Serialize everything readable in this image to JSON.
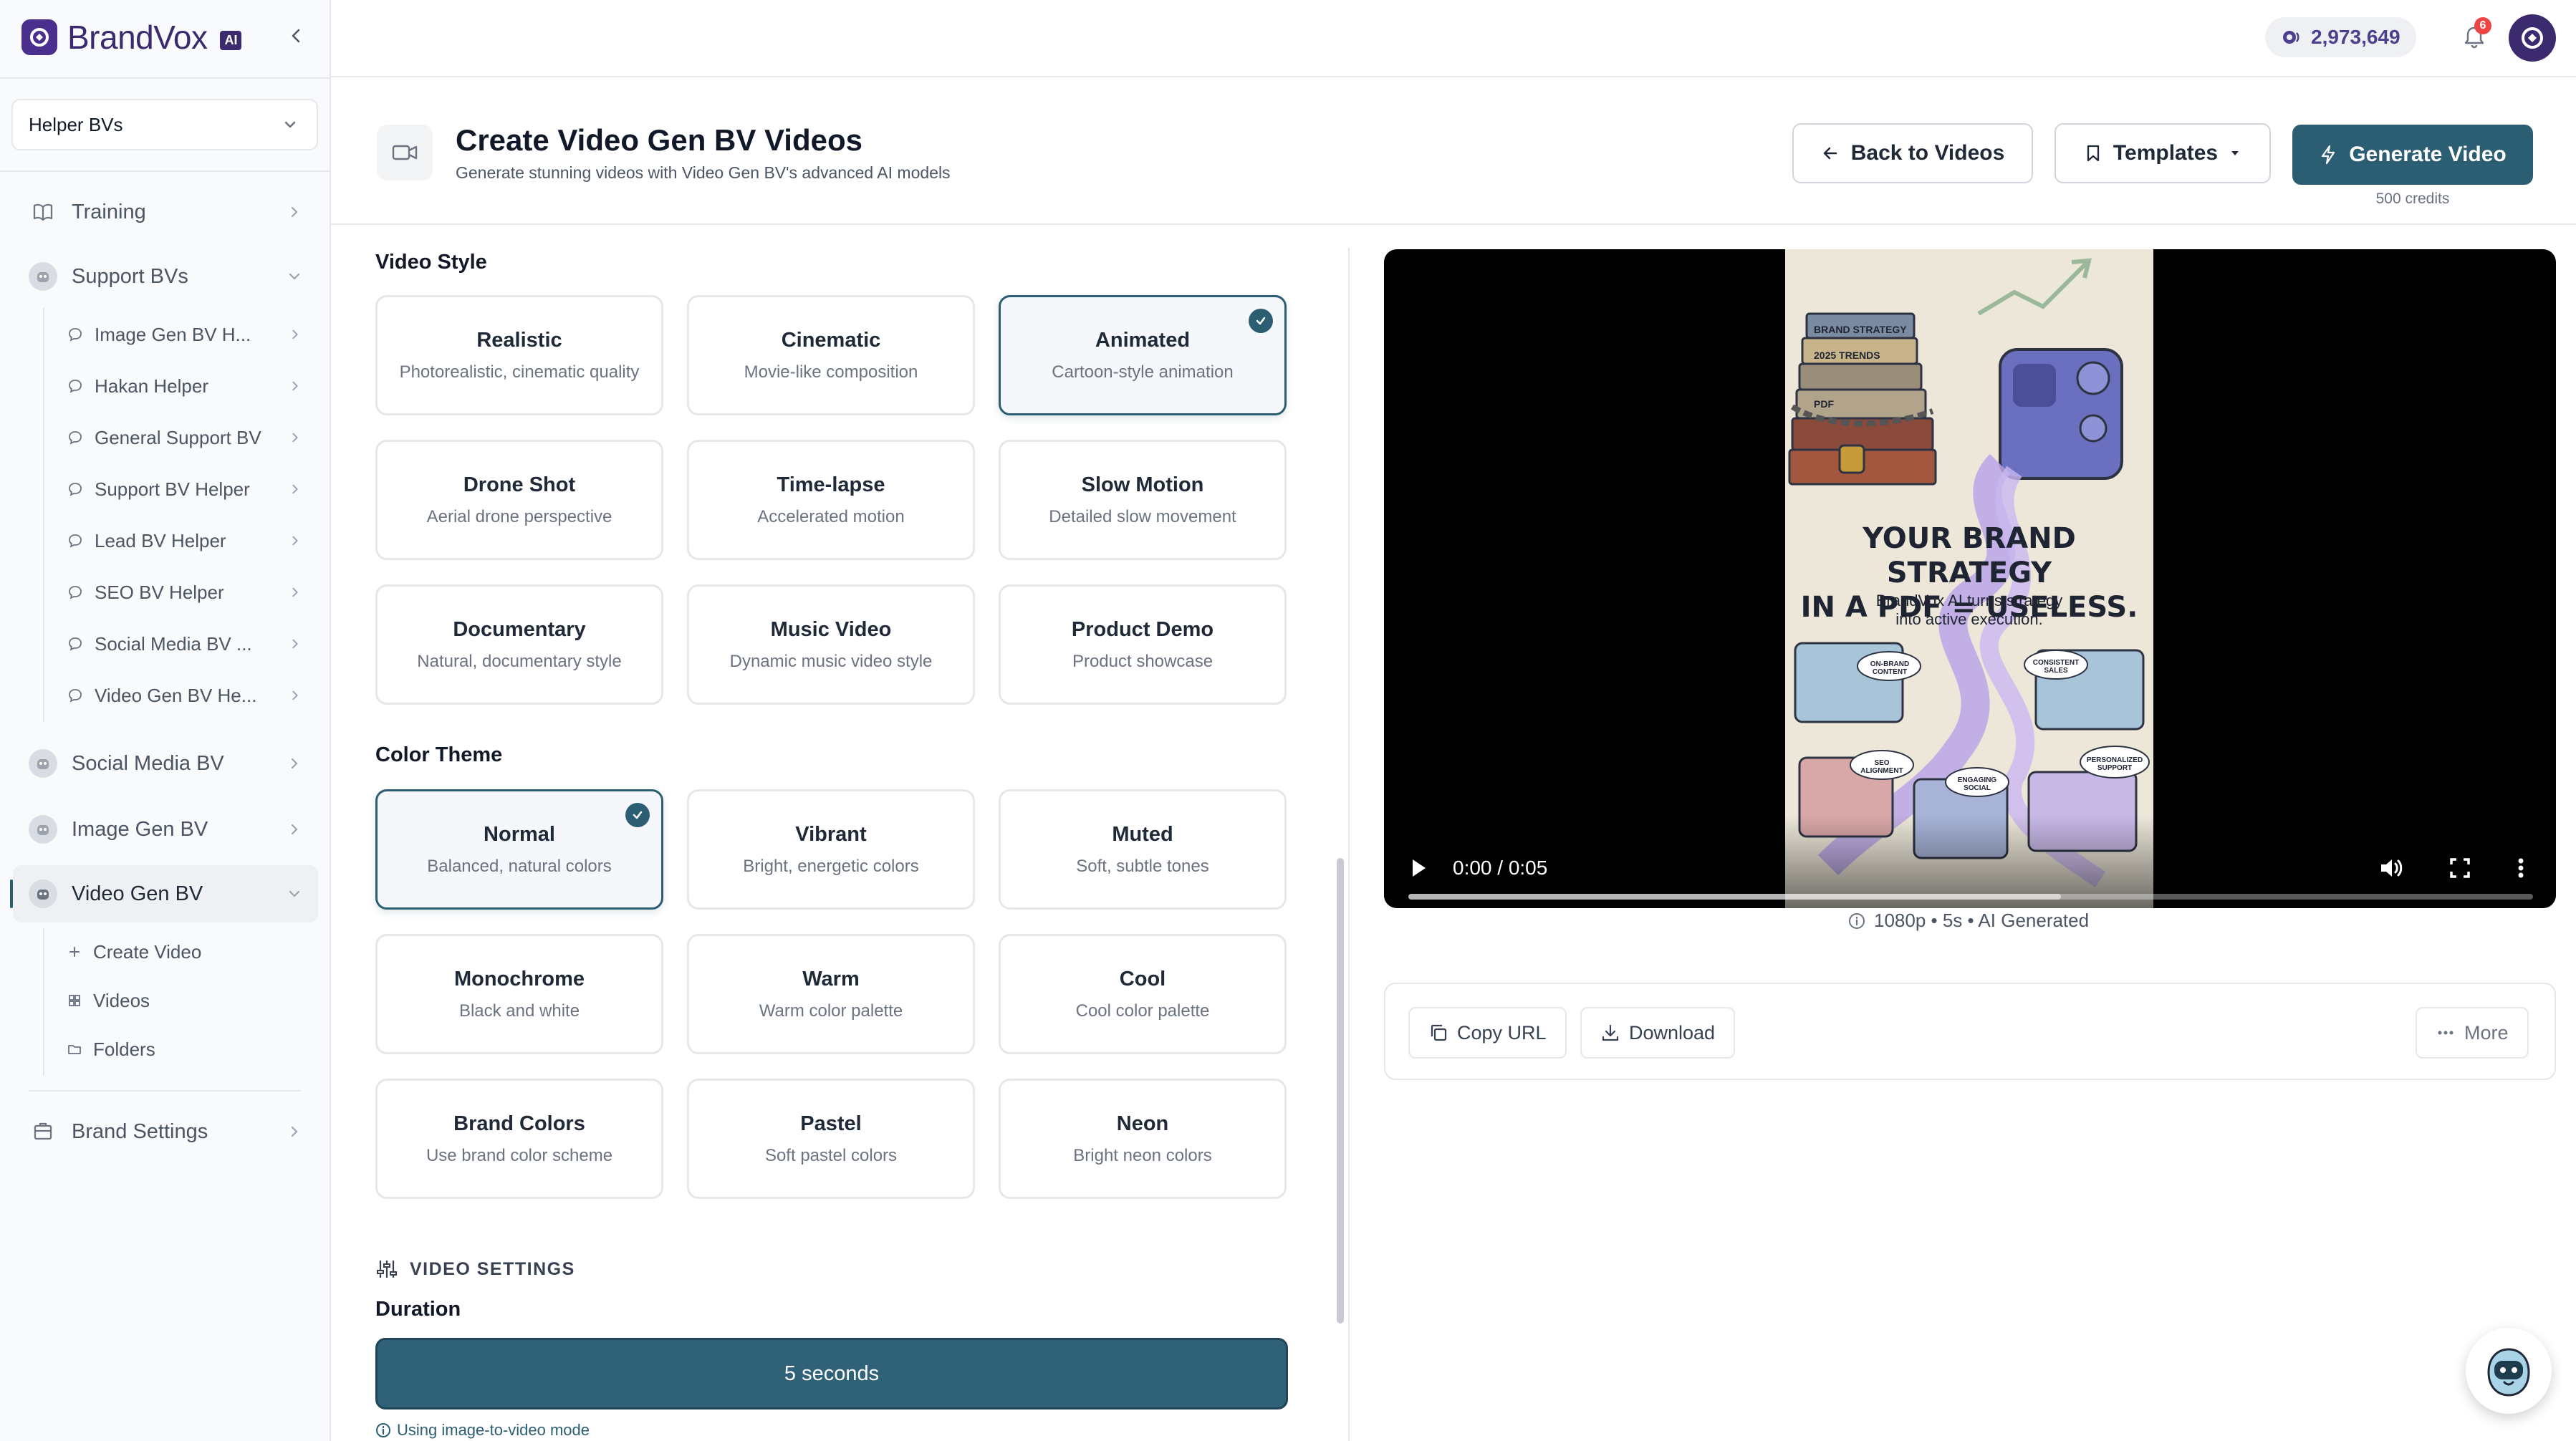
{
  "brand": {
    "name": "BrandVox",
    "badge": "AI"
  },
  "sidebar": {
    "selector_value": "Helper BVs",
    "training": "Training",
    "support_bvs": "Support BVs",
    "support_children": [
      "Image Gen BV H...",
      "Hakan Helper",
      "General Support BV",
      "Support BV Helper",
      "Lead BV Helper",
      "SEO BV Helper",
      "Social Media BV ...",
      "Video Gen BV He..."
    ],
    "social_media_bv": "Social Media BV",
    "image_gen_bv": "Image Gen BV",
    "video_gen_bv": "Video Gen BV",
    "video_children": [
      "Create Video",
      "Videos",
      "Folders"
    ],
    "brand_settings": "Brand Settings"
  },
  "topbar": {
    "credits": "2,973,649",
    "notifications": "6"
  },
  "page": {
    "title": "Create Video Gen BV Videos",
    "subtitle": "Generate stunning videos with Video Gen BV's advanced AI models",
    "back_label": "Back to Videos",
    "templates_label": "Templates",
    "generate_label": "Generate Video",
    "generate_cost": "500 credits"
  },
  "form": {
    "video_style_label": "Video Style",
    "video_styles": [
      {
        "title": "Realistic",
        "desc": "Photorealistic, cinematic quality"
      },
      {
        "title": "Cinematic",
        "desc": "Movie-like composition"
      },
      {
        "title": "Animated",
        "desc": "Cartoon-style animation"
      },
      {
        "title": "Drone Shot",
        "desc": "Aerial drone perspective"
      },
      {
        "title": "Time-lapse",
        "desc": "Accelerated motion"
      },
      {
        "title": "Slow Motion",
        "desc": "Detailed slow movement"
      },
      {
        "title": "Documentary",
        "desc": "Natural, documentary style"
      },
      {
        "title": "Music Video",
        "desc": "Dynamic music video style"
      },
      {
        "title": "Product Demo",
        "desc": "Product showcase"
      }
    ],
    "selected_style": "Animated",
    "color_theme_label": "Color Theme",
    "color_themes": [
      {
        "title": "Normal",
        "desc": "Balanced, natural colors"
      },
      {
        "title": "Vibrant",
        "desc": "Bright, energetic colors"
      },
      {
        "title": "Muted",
        "desc": "Soft, subtle tones"
      },
      {
        "title": "Monochrome",
        "desc": "Black and white"
      },
      {
        "title": "Warm",
        "desc": "Warm color palette"
      },
      {
        "title": "Cool",
        "desc": "Cool color palette"
      },
      {
        "title": "Brand Colors",
        "desc": "Use brand color scheme"
      },
      {
        "title": "Pastel",
        "desc": "Soft pastel colors"
      },
      {
        "title": "Neon",
        "desc": "Bright neon colors"
      }
    ],
    "selected_theme": "Normal",
    "video_settings_label": "VIDEO SETTINGS",
    "duration_label": "Duration",
    "duration_value": "5 seconds",
    "mode_hint": "Using image-to-video mode"
  },
  "preview": {
    "poster_headline_1": "YOUR BRAND STRATEGY",
    "poster_headline_2": "IN A PDF = USELESS.",
    "poster_sub_1": "BrandVox AI turns strategy",
    "poster_sub_2": "into active execution.",
    "poster_book_labels": [
      "BRAND STRATEGY",
      "2025 TRENDS",
      "PDF"
    ],
    "poster_bubbles": [
      "ON-BRAND CONTENT",
      "CONSISTENT SALES",
      "SEO ALIGNMENT",
      "ENGAGING SOCIAL",
      "PERSONALIZED SUPPORT"
    ],
    "time": "0:00 / 0:05",
    "progress": 0.58,
    "meta": "1080p • 5s • AI Generated",
    "copy_url": "Copy URL",
    "download": "Download",
    "more": "More"
  },
  "colors": {
    "accent": "#2b5d73",
    "brand": "#3b2a6e"
  },
  "icons": [
    "book-icon",
    "chevron-right-icon",
    "chevron-down-icon",
    "chat-bubble-icon",
    "plus-icon",
    "grid-icon",
    "folder-icon",
    "building-icon",
    "bell-icon",
    "coin-icon",
    "video-camera-icon",
    "arrow-left-icon",
    "bookmark-icon",
    "lightning-icon",
    "check-icon",
    "sliders-icon",
    "info-icon",
    "play-icon",
    "volume-icon",
    "fullscreen-icon",
    "more-vertical-icon",
    "copy-icon",
    "download-icon",
    "more-horizontal-icon"
  ]
}
